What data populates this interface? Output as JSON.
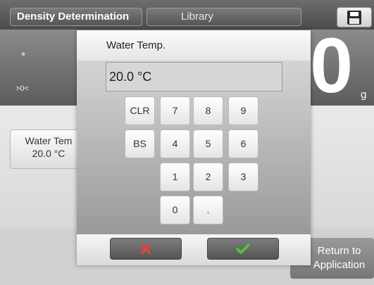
{
  "topbar": {
    "tabs": [
      {
        "label": "Density Determination"
      },
      {
        "label": "Library"
      }
    ],
    "save_icon": "floppy-disk-icon"
  },
  "display": {
    "stability_indicator": "*",
    "zero_indicator": ">0<",
    "reading": "0",
    "unit": "g"
  },
  "parameter_card": {
    "label": "Water Tem",
    "value": "20.0 °C"
  },
  "return_button": {
    "line1": "Return to",
    "line2": "Application"
  },
  "dialog": {
    "title": "Water Temp.",
    "value": "20.0 °C",
    "keys": {
      "clr": "CLR",
      "bs": "BS",
      "k7": "7",
      "k8": "8",
      "k9": "9",
      "k4": "4",
      "k5": "5",
      "k6": "6",
      "k1": "1",
      "k2": "2",
      "k3": "3",
      "k0": "0",
      "dot": "."
    },
    "cancel_icon": "red-x-icon",
    "confirm_icon": "green-check-icon",
    "colors": {
      "cancel": "#e0453a",
      "confirm": "#4fc233"
    }
  }
}
